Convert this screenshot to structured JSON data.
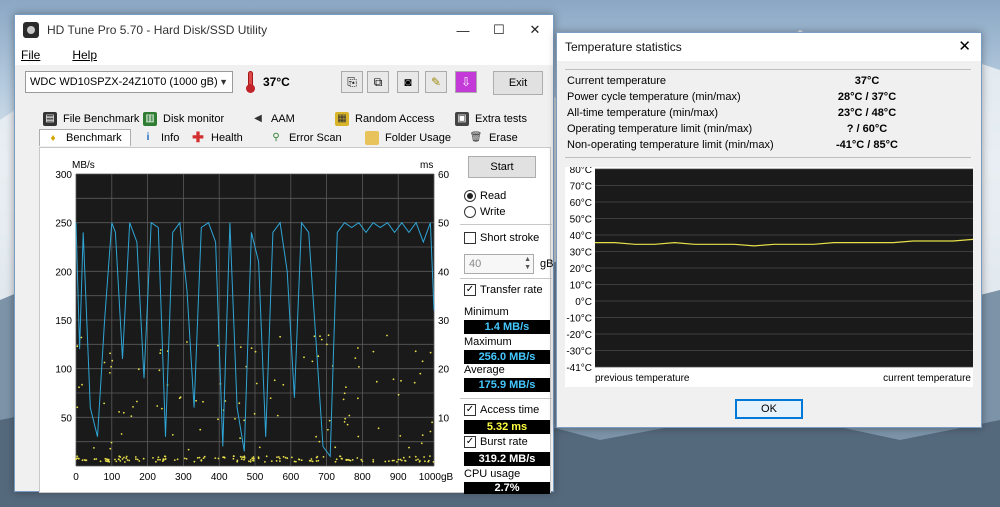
{
  "hdtune": {
    "title": "HD Tune Pro 5.70 - Hard Disk/SSD Utility",
    "menu": [
      "File",
      "Help"
    ],
    "drive": "WDC WD10SPZX-24Z10T0 (1000 gB)",
    "temperature": "37°C",
    "exit_label": "Exit",
    "tabs_row1": [
      "File Benchmark",
      "Disk monitor",
      "AAM",
      "Random Access",
      "Extra tests"
    ],
    "tabs_row2": [
      "Benchmark",
      "Info",
      "Health",
      "Error Scan",
      "Folder Usage",
      "Erase"
    ],
    "start_label": "Start",
    "read_label": "Read",
    "write_label": "Write",
    "short_stroke_label": "Short stroke",
    "short_stroke_value": "40",
    "short_stroke_unit": "gB",
    "transfer_rate_label": "Transfer rate",
    "minimum_label": "Minimum",
    "minimum_value": "1.4 MB/s",
    "maximum_label": "Maximum",
    "maximum_value": "256.0 MB/s",
    "average_label": "Average",
    "average_value": "175.9 MB/s",
    "access_time_label": "Access time",
    "access_time_value": "5.32 ms",
    "burst_rate_label": "Burst rate",
    "burst_rate_value": "319.2 MB/s",
    "cpu_usage_label": "CPU usage",
    "cpu_usage_value": "2.7%",
    "graph": {
      "left_unit": "MB/s",
      "right_unit": "ms",
      "left_ticks": [
        "300",
        "250",
        "200",
        "150",
        "100",
        "50"
      ],
      "right_ticks": [
        "60",
        "50",
        "40",
        "30",
        "20",
        "10"
      ],
      "x_ticks": [
        "0",
        "100",
        "200",
        "300",
        "400",
        "500",
        "600",
        "700",
        "800",
        "900",
        "1000gB"
      ]
    }
  },
  "tempstats": {
    "title": "Temperature statistics",
    "rows": [
      {
        "label": "Current temperature",
        "value": "37°C"
      },
      {
        "label": "Power cycle temperature (min/max)",
        "value": "28°C / 37°C"
      },
      {
        "label": "All-time temperature (min/max)",
        "value": "23°C / 48°C"
      },
      {
        "label": "Operating temperature limit (min/max)",
        "value": "? / 60°C"
      },
      {
        "label": "Non-operating temperature limit (min/max)",
        "value": "-41°C / 85°C"
      }
    ],
    "y_ticks": [
      "80°C",
      "70°C",
      "60°C",
      "50°C",
      "40°C",
      "30°C",
      "20°C",
      "10°C",
      "0°C",
      "-10°C",
      "-20°C",
      "-30°C",
      "-41°C"
    ],
    "x_left_label": "previous temperature",
    "x_right_label": "current temperature",
    "ok_label": "OK"
  },
  "chart_data": [
    {
      "type": "line",
      "series": [
        {
          "name": "",
          "y_axis": "MB/s",
          "ylim": [
            0,
            300
          ],
          "x": [
            0,
            10,
            20,
            40,
            60,
            80,
            100,
            110,
            130,
            150,
            170,
            190,
            210,
            230,
            250,
            270,
            290,
            310,
            330,
            350,
            370,
            390,
            410,
            430,
            450,
            470,
            490,
            510,
            530,
            550,
            570,
            590,
            610,
            630,
            650,
            670,
            690,
            710,
            730,
            750,
            770,
            790,
            810,
            830,
            850,
            870,
            890,
            910,
            930,
            950,
            970,
            990,
            1000
          ],
          "values": [
            250,
            120,
            240,
            60,
            30,
            150,
            250,
            240,
            110,
            250,
            230,
            90,
            250,
            245,
            30,
            240,
            250,
            180,
            60,
            245,
            250,
            230,
            20,
            250,
            60,
            15,
            240,
            210,
            30,
            240,
            250,
            200,
            70,
            250,
            240,
            130,
            20,
            10,
            240,
            250,
            245,
            250,
            240,
            250,
            245,
            250,
            240,
            250,
            240,
            250,
            230,
            250,
            160
          ]
        }
      ],
      "xlim": [
        0,
        1000
      ],
      "x_unit": "gB",
      "grid": true
    },
    {
      "type": "line",
      "series": [
        {
          "name": "",
          "values": [
            35,
            35,
            34,
            34,
            35,
            34,
            34,
            34,
            33,
            34,
            34,
            34,
            35,
            35,
            35,
            35,
            36,
            36,
            36,
            37
          ]
        }
      ],
      "ylim": [
        -41,
        80
      ],
      "grid": true
    }
  ]
}
